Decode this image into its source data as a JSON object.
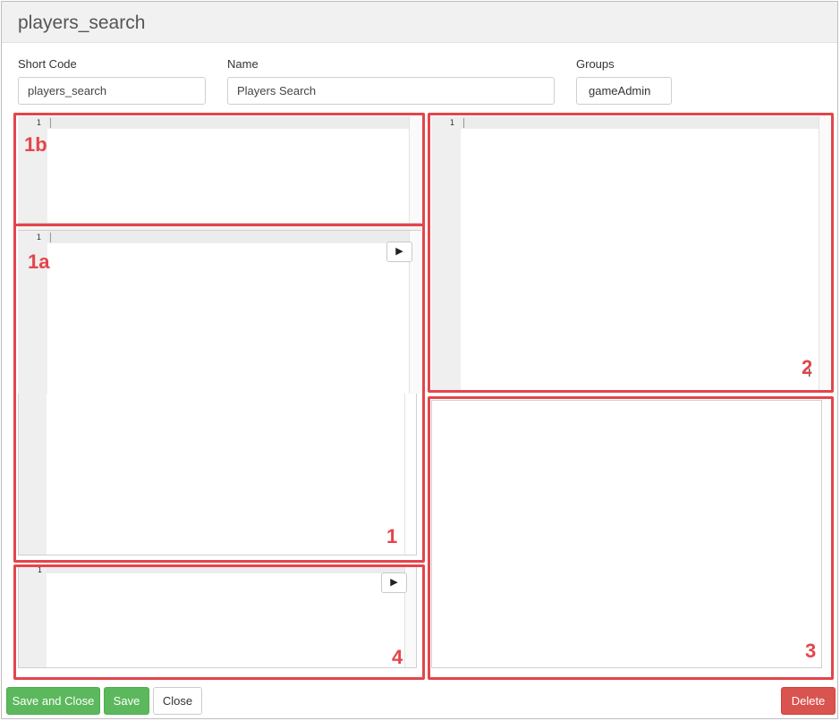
{
  "window": {
    "title": "players_search"
  },
  "form": {
    "short_code": {
      "label": "Short Code",
      "value": "players_search"
    },
    "name": {
      "label": "Name",
      "value": "Players Search"
    },
    "groups": {
      "label": "Groups",
      "value": "gameAdmin"
    }
  },
  "editors": {
    "line_number": "1",
    "run_icon": "▶"
  },
  "annotations": {
    "label_1b": "1b",
    "label_1a": "1a",
    "label_1": "1",
    "label_2": "2",
    "label_3": "3",
    "label_4": "4",
    "color": "#e3454b"
  },
  "footer": {
    "save_and_close": "Save and Close",
    "save": "Save",
    "close": "Close",
    "delete": "Delete"
  },
  "colors": {
    "green": "#5cb85c",
    "red": "#d9534f",
    "annotation_red": "#e3454b"
  }
}
